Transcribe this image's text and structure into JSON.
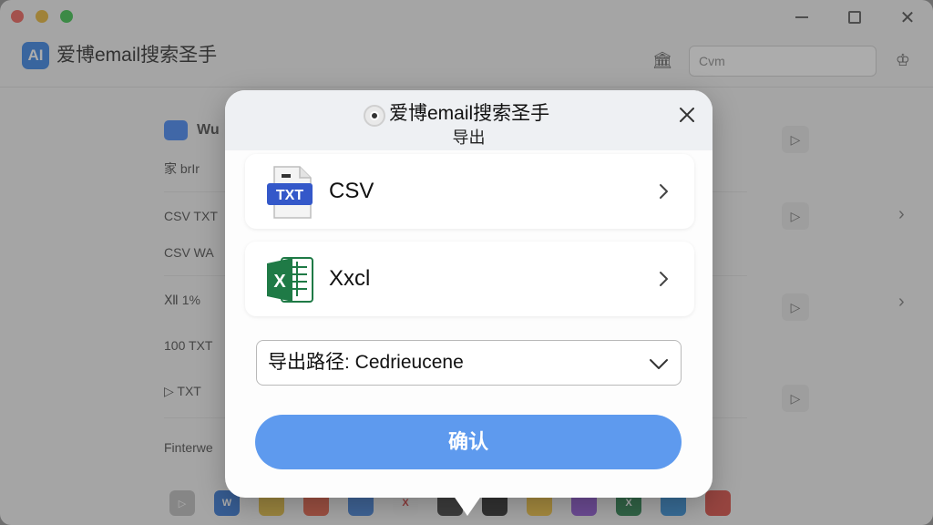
{
  "app": {
    "name": "爱博email搜索圣手",
    "logo_text": "AI"
  },
  "header": {
    "search_value": "Cvm"
  },
  "background": {
    "section_title": "Wu",
    "rows": [
      {
        "label": "家  brIr"
      },
      {
        "label": "CSV  TXT"
      },
      {
        "label": "CSV  WA"
      },
      {
        "label": "Ⅻ  1%"
      },
      {
        "label": "100  TXT"
      },
      {
        "label": "▷  TXT"
      },
      {
        "label": "Finterwe"
      }
    ]
  },
  "dialog": {
    "title": "爱博email搜索圣手",
    "subtitle": "导出",
    "options": [
      {
        "label": "CSV",
        "icon": "txt-file-icon",
        "icon_text": "TXT"
      },
      {
        "label": "Xxcl",
        "icon": "excel-icon",
        "icon_text": "X"
      }
    ],
    "path_label": "导出路径: Cedrieucene",
    "confirm_label": "确认"
  },
  "colors": {
    "accent": "#5e9aee",
    "excel_green": "#1f7a46",
    "txt_blue": "#3458c9"
  }
}
